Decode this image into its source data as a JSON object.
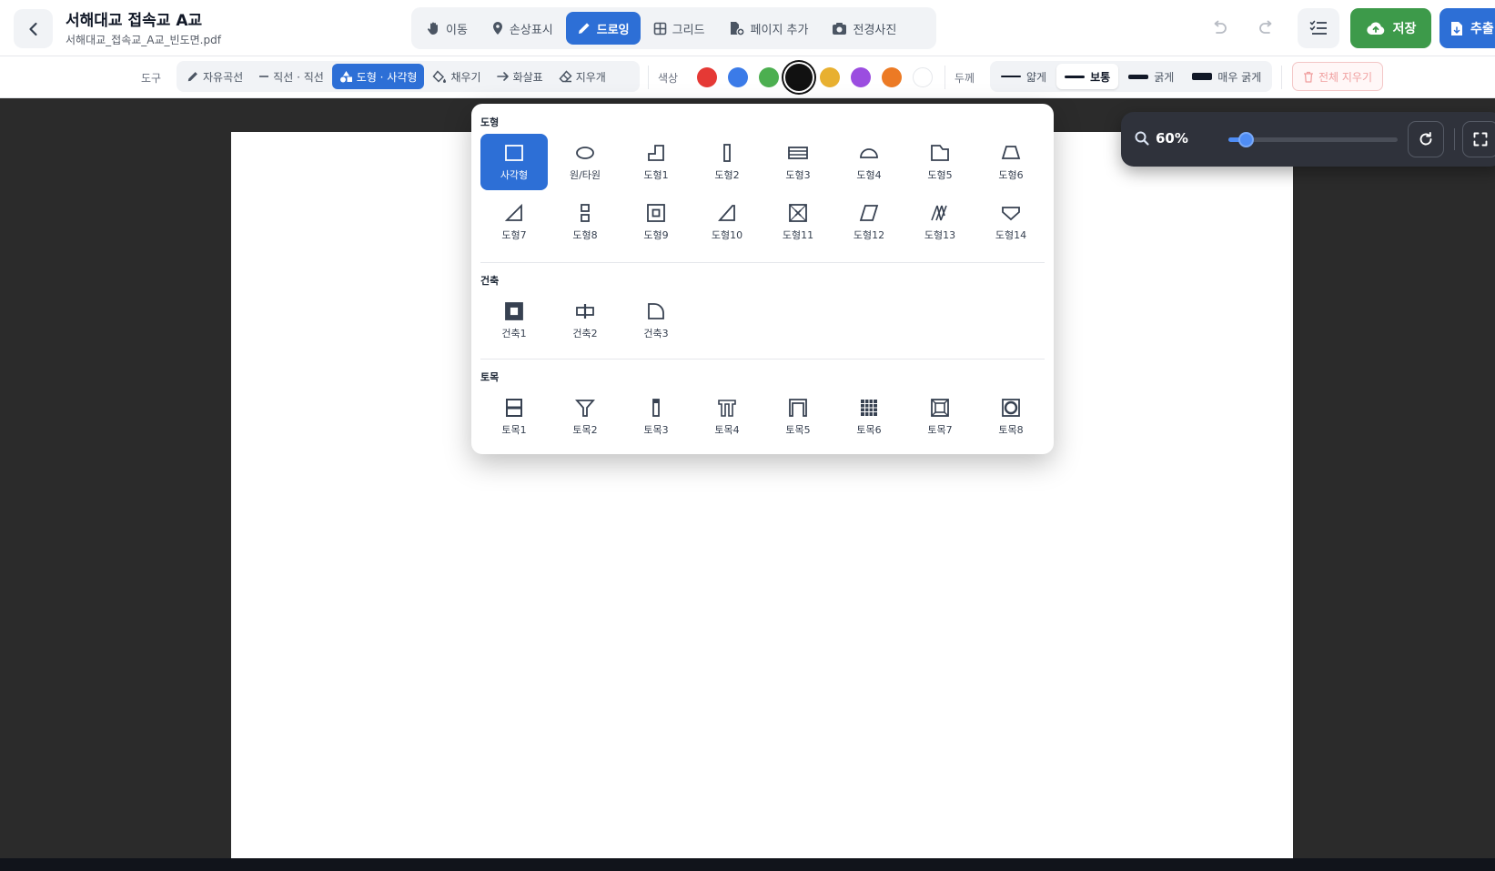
{
  "header": {
    "title": "서해대교 접속교 A교",
    "filename": "서해대교_접속교_A교_빈도면.pdf",
    "modes": [
      {
        "label": "이동",
        "icon": "hand-icon",
        "active": false
      },
      {
        "label": "손상표시",
        "icon": "map-pin-icon",
        "active": false
      },
      {
        "label": "드로잉",
        "icon": "pencil-icon",
        "active": true
      },
      {
        "label": "그리드",
        "icon": "grid-icon",
        "active": false
      },
      {
        "label": "페이지 추가",
        "icon": "file-add-icon",
        "active": false
      },
      {
        "label": "전경사진",
        "icon": "camera-icon",
        "active": false
      }
    ],
    "save_label": "저장",
    "extract_label": "추출"
  },
  "toolbar": {
    "tool_label": "도구",
    "tools": [
      {
        "label": "자유곡선",
        "icon": "pencil-icon",
        "active": false
      },
      {
        "label": "직선 · 직선",
        "icon": "line-icon",
        "active": false
      },
      {
        "label": "도형 · 사각형",
        "icon": "shapes-icon",
        "active": true
      },
      {
        "label": "채우기",
        "icon": "paint-bucket-icon",
        "active": false
      },
      {
        "label": "화살표",
        "icon": "arrow-right-icon",
        "active": false
      },
      {
        "label": "지우개",
        "icon": "eraser-icon",
        "active": false
      }
    ],
    "color_label": "색상",
    "colors": [
      "#e53935",
      "#3b7be8",
      "#4caf50",
      "#111111",
      "#e8b030",
      "#9b4de0",
      "#ec7a24",
      "#ffffff"
    ],
    "selected_color": "#111111",
    "thickness_label": "두께",
    "thicknesses": [
      {
        "label": "얇게",
        "active": false
      },
      {
        "label": "보통",
        "active": true
      },
      {
        "label": "굵게",
        "active": false
      },
      {
        "label": "매우 굵게",
        "active": false
      }
    ],
    "clear_label": "전체 지우기"
  },
  "zoom": {
    "value_label": "60%",
    "level": 0.1
  },
  "palette": {
    "sections": [
      {
        "title": "도형",
        "items": [
          "사각형",
          "원/타원",
          "도형1",
          "도형2",
          "도형3",
          "도형4",
          "도형5",
          "도형6",
          "도형7",
          "도형8",
          "도형9",
          "도형10",
          "도형11",
          "도형12",
          "도형13",
          "도형14"
        ],
        "selected": "사각형"
      },
      {
        "title": "건축",
        "items": [
          "건축1",
          "건축2",
          "건축3"
        ]
      },
      {
        "title": "토목",
        "items": [
          "토목1",
          "토목2",
          "토목3",
          "토목4",
          "토목5",
          "토목6",
          "토목7",
          "토목8"
        ]
      }
    ]
  }
}
